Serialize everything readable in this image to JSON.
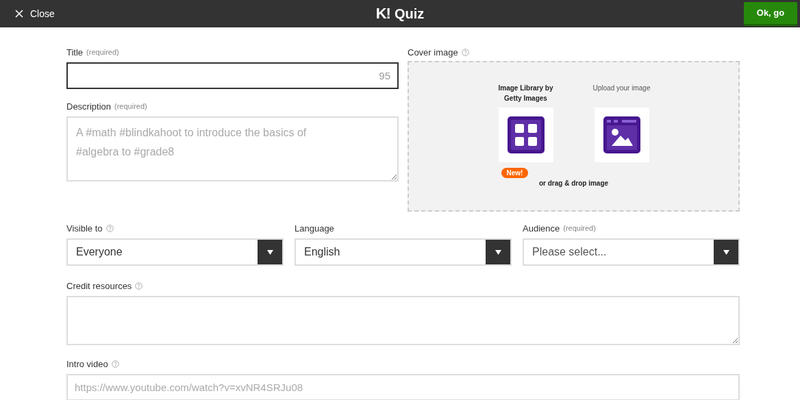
{
  "top_bar": {
    "close_label": "Close",
    "logo": "K!",
    "title": "Quiz",
    "confirm_button": "Ok, go"
  },
  "title_field": {
    "label": "Title",
    "note": "(required)",
    "counter": "95",
    "focused": true
  },
  "description_field": {
    "label": "Description",
    "note": "(required)",
    "placeholder": "A #math #blindkahoot to introduce the basics of #algebra to #grade8"
  },
  "cover_image": {
    "label": "Cover image",
    "help": true,
    "options": [
      {
        "kind": "library",
        "label": "Image Library by Getty Images",
        "badge": "New!"
      },
      {
        "kind": "upload",
        "label": "Upload your image"
      }
    ],
    "drop_hint": "or drag & drop image"
  },
  "selects": [
    {
      "label": "Visible to",
      "help": true,
      "value": "Everyone"
    },
    {
      "label": "Language",
      "help": false,
      "value": "English"
    },
    {
      "label": "Audience",
      "help": false,
      "note": "(required)",
      "placeholder": "Please select..."
    }
  ],
  "credit_resources": {
    "label": "Credit resources",
    "help": true
  },
  "intro_video": {
    "label": "Intro video",
    "help": true,
    "placeholder": "https://www.youtube.com/watch?v=xvNR4SRJu08"
  }
}
